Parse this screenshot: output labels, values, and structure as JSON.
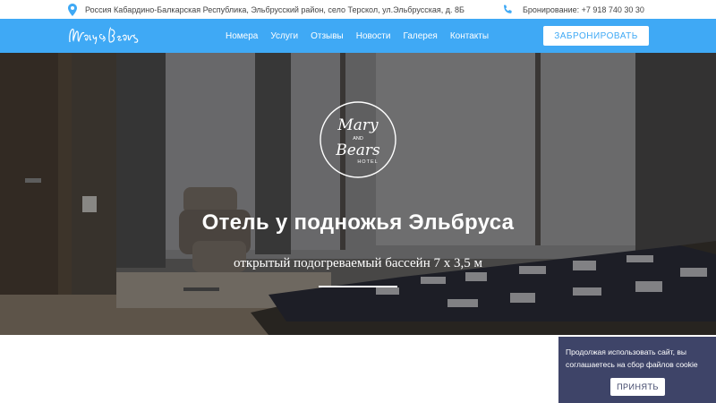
{
  "topbar": {
    "address": "Россия Кабардино-Балкарская Республика, Эльбрусский район, село Терскол, ул.Эльбрусская, д. 8Б",
    "phone": "Бронирование: +7 918 740 30 30",
    "icons": [
      "map-pin-icon",
      "phone-icon"
    ]
  },
  "nav": {
    "logo_text": "Mary & Bears",
    "items": [
      "Номера",
      "Услуги",
      "Отзывы",
      "Новости",
      "Галерея",
      "Контакты"
    ],
    "book_button": "ЗАБРОНИРОВАТЬ"
  },
  "hero": {
    "logo": {
      "line1": "Mary",
      "and": "AND",
      "line2": "Bears",
      "hotel": "HOTEL"
    },
    "title": "Отель у подножья Эльбруса",
    "subtitle": "открытый подогреваемый бассейн 7 х 3,5 м"
  },
  "cookie": {
    "text": "Продолжая использовать сайт, вы соглашаетесь на сбор файлов cookie",
    "button": "ПРИНЯТЬ"
  },
  "colors": {
    "nav_blue": "#3fa9f5",
    "cookie_bg": "#3e4468",
    "icon_blue": "#3fa9f5"
  }
}
